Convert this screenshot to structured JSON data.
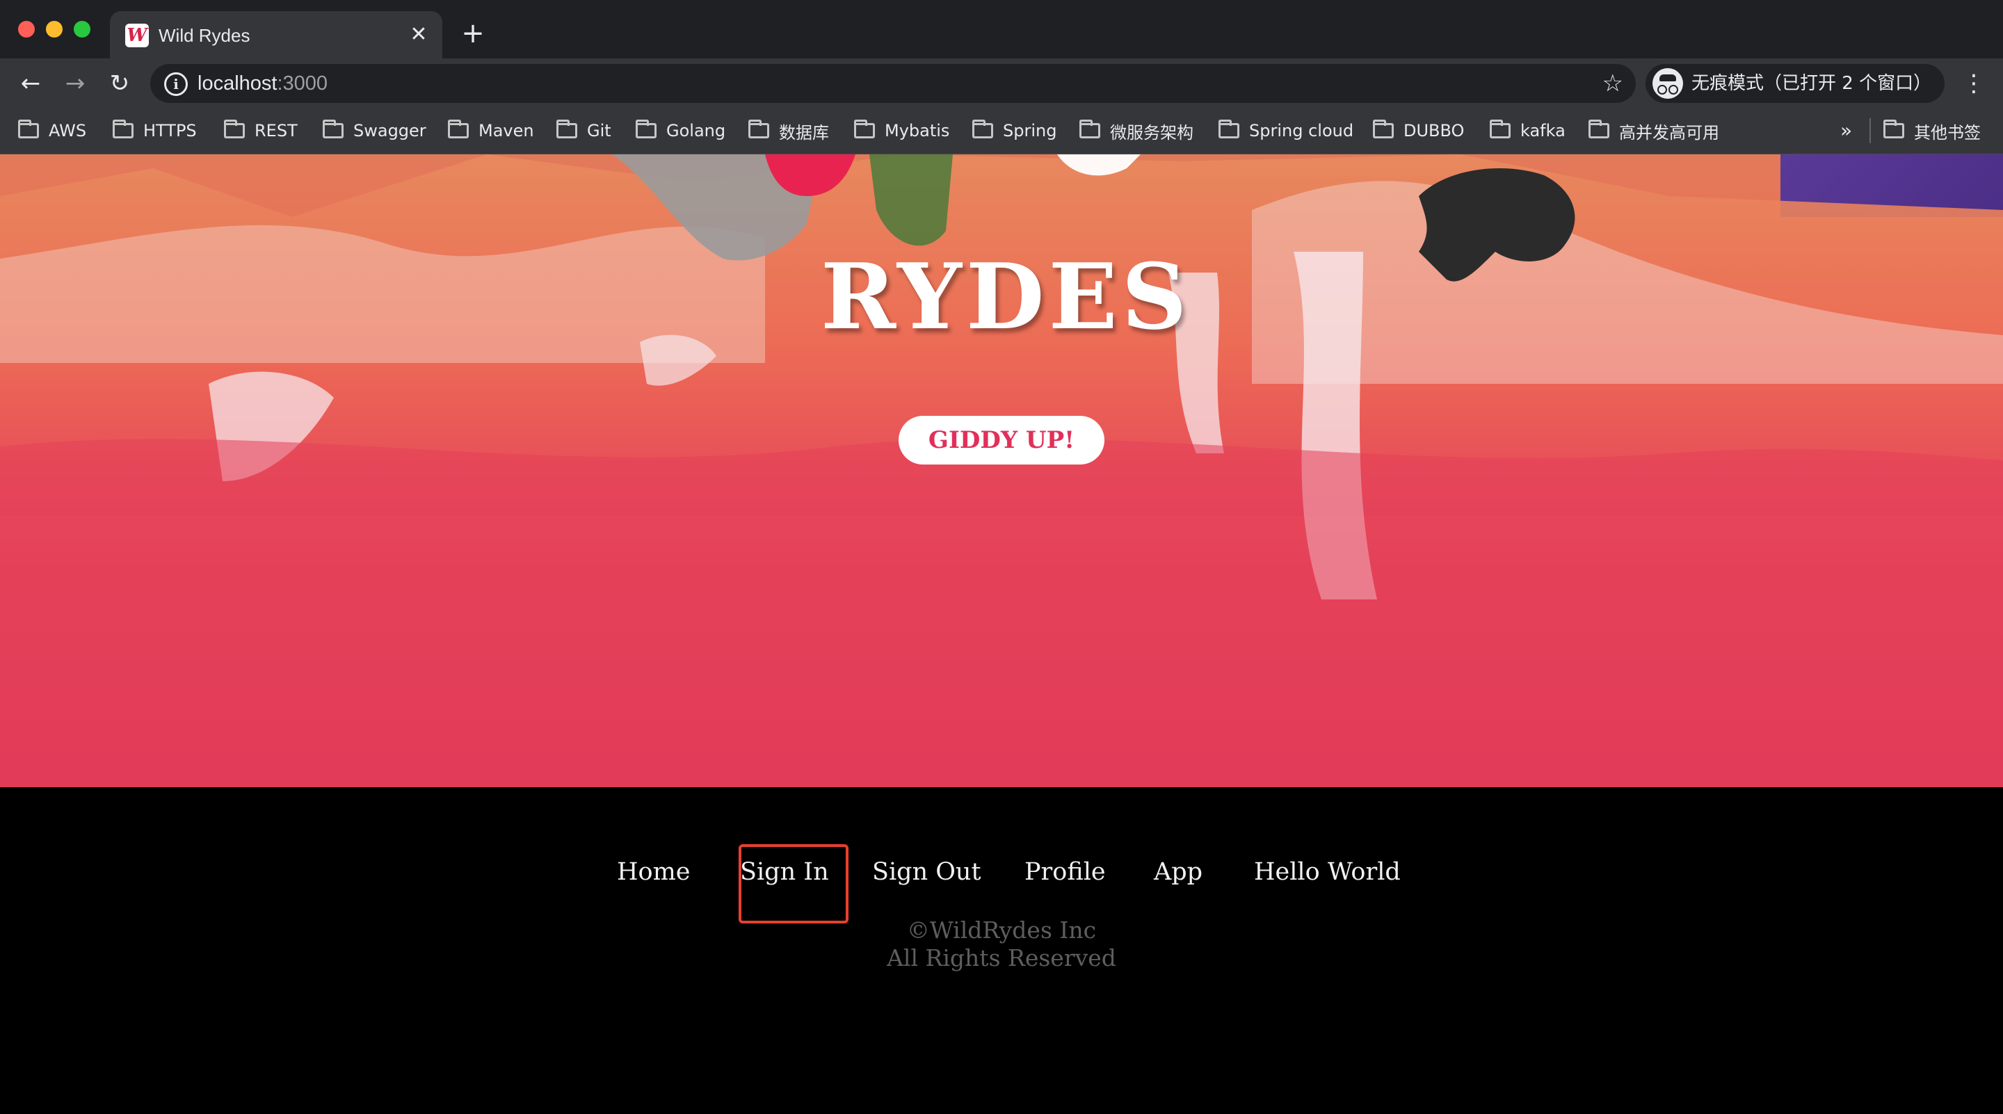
{
  "browser": {
    "tab": {
      "title": "Wild Rydes",
      "favicon": "W",
      "close_glyph": "✕"
    },
    "new_tab_glyph": "+",
    "nav": {
      "back": "←",
      "forward": "→",
      "reload": "↻"
    },
    "omnibox": {
      "host": "localhost",
      "port": ":3000",
      "info_glyph": "i",
      "star_glyph": "☆"
    },
    "incognito": {
      "label": "无痕模式（已打开 2 个窗口）"
    },
    "menu_glyph": "⋮",
    "bookmarks": [
      {
        "label": "AWS"
      },
      {
        "label": "HTTPS"
      },
      {
        "label": "REST"
      },
      {
        "label": "Swagger"
      },
      {
        "label": "Maven"
      },
      {
        "label": "Git"
      },
      {
        "label": "Golang"
      },
      {
        "label": "数据库"
      },
      {
        "label": "Mybatis"
      },
      {
        "label": "Spring"
      },
      {
        "label": "微服务架构"
      },
      {
        "label": "Spring cloud"
      },
      {
        "label": "DUBBO"
      },
      {
        "label": "kafka"
      },
      {
        "label": "高并发高可用"
      }
    ],
    "bookmarks_more": "»",
    "other_bookmarks": "其他书签"
  },
  "hero": {
    "title": "RYDES",
    "cta_label": "GIDDY UP!"
  },
  "footer": {
    "nav": [
      "Home",
      "Sign In",
      "Sign Out",
      "Profile",
      "App",
      "Hello World"
    ],
    "highlighted": "Sign In",
    "copyright_line1": "©WildRydes Inc",
    "copyright_line2": "All Rights Reserved"
  },
  "colors": {
    "brand": "#e1355a",
    "highlight_box": "#e8402e"
  }
}
